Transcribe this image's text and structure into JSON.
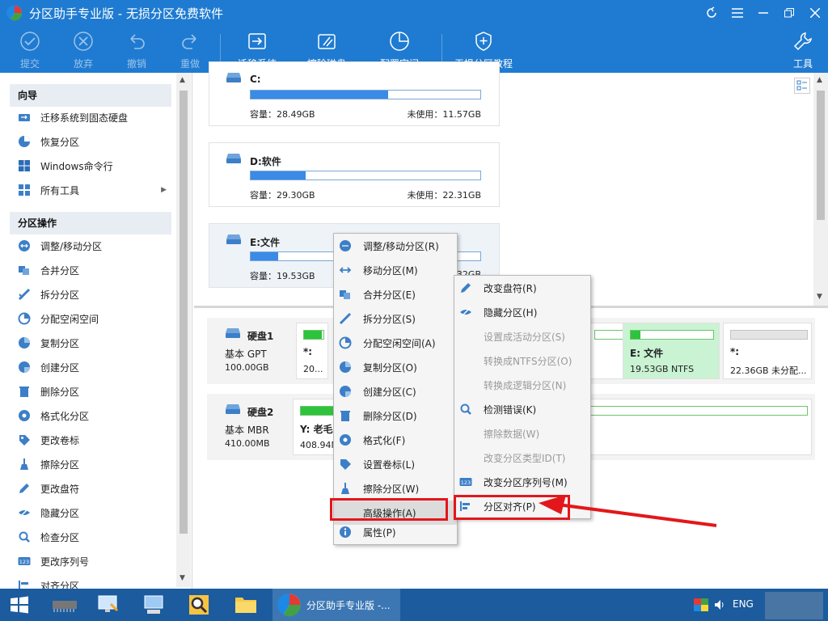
{
  "window": {
    "title": "分区助手专业版 - 无损分区免费软件"
  },
  "toolbar": {
    "commit": "提交",
    "discard": "放弃",
    "undo": "撤销",
    "redo": "重做",
    "migrate": "迁移系统",
    "wipe": "擦除磁盘",
    "allocate": "配置空间",
    "tutorial": "无损分区教程",
    "tools": "工具"
  },
  "sidebar": {
    "wizard_header": "向导",
    "wizard": [
      "迁移系统到固态硬盘",
      "恢复分区",
      "Windows命令行",
      "所有工具"
    ],
    "ops_header": "分区操作",
    "ops": [
      "调整/移动分区",
      "合并分区",
      "拆分分区",
      "分配空闲空间",
      "复制分区",
      "创建分区",
      "删除分区",
      "格式化分区",
      "更改卷标",
      "擦除分区",
      "更改盘符",
      "隐藏分区",
      "检查分区",
      "更改序列号",
      "对齐分区"
    ]
  },
  "partitions": [
    {
      "name": "C:",
      "capacity": "容量：28.49GB",
      "free": "未使用：11.57GB",
      "used": 0.6
    },
    {
      "name": "D:软件",
      "capacity": "容量：29.30GB",
      "free": "未使用：22.31GB",
      "used": 0.24
    },
    {
      "name": "E:文件",
      "capacity": "容量：19.53GB",
      "free": "32GB",
      "used": 0.12
    }
  ],
  "disks": [
    {
      "name": "硬盘1",
      "type": "基本 GPT",
      "size": "100.00GB",
      "parts": [
        {
          "label": "*:",
          "detail": "20...",
          "used": 0.9
        },
        {
          "label": "E: 文件",
          "detail": "19.53GB NTFS",
          "used": 0.12
        },
        {
          "label": "*:",
          "detail": "22.36GB 未分配...",
          "used": 0
        }
      ]
    },
    {
      "name": "硬盘2",
      "type": "基本 MBR",
      "size": "410.00MB",
      "parts": [
        {
          "label": "Y: 老毛",
          "detail": "408.94M",
          "used": 0.1
        }
      ]
    }
  ],
  "menu1": [
    "调整/移动分区(R)",
    "移动分区(M)",
    "合并分区(E)",
    "拆分分区(S)",
    "分配空闲空间(A)",
    "复制分区(O)",
    "创建分区(C)",
    "删除分区(D)",
    "格式化(F)",
    "设置卷标(L)",
    "擦除分区(W)",
    "高级操作(A)",
    "属性(P)"
  ],
  "menu2": [
    "改变盘符(R)",
    "隐藏分区(H)",
    "设置成活动分区(S)",
    "转换成NTFS分区(O)",
    "转换成逻辑分区(N)",
    "检测错误(K)",
    "擦除数据(W)",
    "改变分区类型ID(T)",
    "改变分区序列号(M)",
    "分区对齐(P)"
  ],
  "taskbar": {
    "active_app": "分区助手专业版 -...",
    "lang": "ENG"
  },
  "colors": {
    "titlebar": "#1f7bd1",
    "accent": "#3b8ae6",
    "highlight_box": "#e3171b",
    "disk_used": "#2ec33c"
  }
}
